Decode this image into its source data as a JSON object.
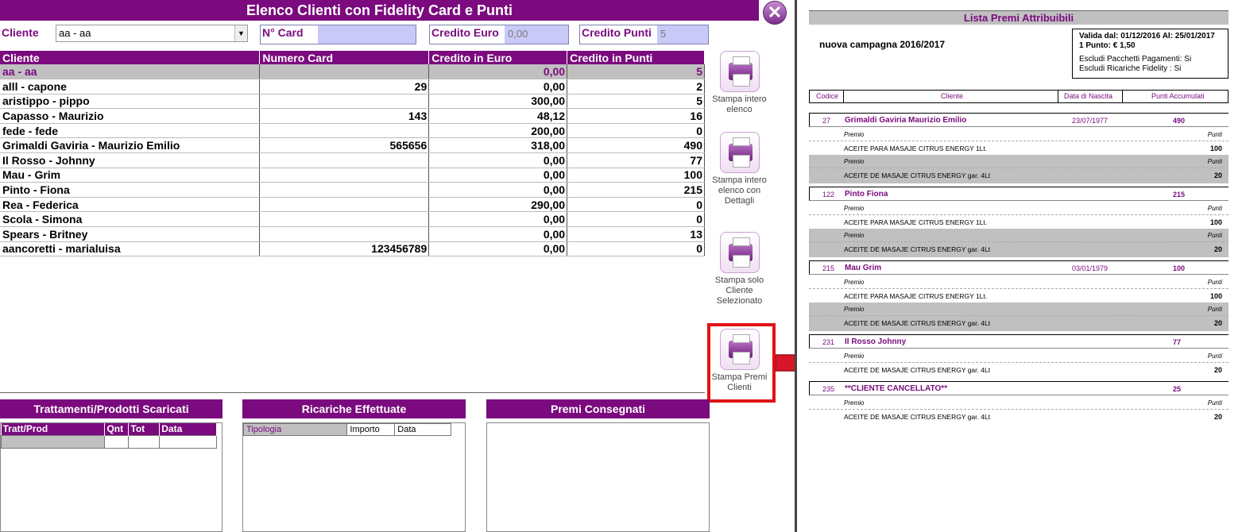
{
  "app": {
    "title": "Elenco Clienti con Fidelity Card e Punti",
    "close_icon": "close-icon"
  },
  "filters": {
    "cliente_label": "Cliente",
    "cliente_value": "aa - aa",
    "card_label": "N° Card",
    "card_value": "",
    "credito_euro_label": "Credito Euro",
    "credito_euro_value": "0,00",
    "credito_punti_label": "Credito Punti",
    "credito_punti_value": "5"
  },
  "table": {
    "headers": [
      "Cliente",
      "Numero Card",
      "Credito in Euro",
      "Credito in Punti"
    ],
    "rows": [
      {
        "cliente": "aa - aa",
        "card": "",
        "euro": "0,00",
        "punti": "5"
      },
      {
        "cliente": "alll - capone",
        "card": "29",
        "euro": "0,00",
        "punti": "2"
      },
      {
        "cliente": "aristippo - pippo",
        "card": "",
        "euro": "300,00",
        "punti": "5"
      },
      {
        "cliente": "Capasso - Maurizio",
        "card": "143",
        "euro": "48,12",
        "punti": "16"
      },
      {
        "cliente": "fede - fede",
        "card": "",
        "euro": "200,00",
        "punti": "0"
      },
      {
        "cliente": "Grimaldi Gaviria - Maurizio Emilio",
        "card": "565656",
        "euro": "318,00",
        "punti": "490"
      },
      {
        "cliente": "Il Rosso - Johnny",
        "card": "",
        "euro": "0,00",
        "punti": "77"
      },
      {
        "cliente": "Mau - Grim",
        "card": "",
        "euro": "0,00",
        "punti": "100"
      },
      {
        "cliente": "Pinto - Fiona",
        "card": "",
        "euro": "0,00",
        "punti": "215"
      },
      {
        "cliente": "Rea - Federica",
        "card": "",
        "euro": "290,00",
        "punti": "0"
      },
      {
        "cliente": "Scola - Simona",
        "card": "",
        "euro": "0,00",
        "punti": "0"
      },
      {
        "cliente": "Spears - Britney",
        "card": "",
        "euro": "0,00",
        "punti": "13"
      },
      {
        "cliente": "aancoretti - marialuisa",
        "card": "123456789",
        "euro": "0,00",
        "punti": "0"
      }
    ]
  },
  "side_buttons": {
    "b1": "Stampa intero elenco",
    "b2": "Stampa intero elenco con Dettagli",
    "b3": "Stampa solo Cliente Selezionato",
    "b4": "Stampa Premi Clienti"
  },
  "panels": {
    "trattamenti": {
      "title": "Trattamenti/Prodotti Scaricati",
      "headers": [
        "Tratt/Prod",
        "Qnt",
        "Tot",
        "Data"
      ]
    },
    "ricariche": {
      "title": "Ricariche Effettuate",
      "headers": [
        "Tipologia",
        "Importo",
        "Data"
      ]
    },
    "premi": {
      "title": "Premi Consegnati"
    }
  },
  "report": {
    "title": "Lista Premi Attribuibili",
    "campaign": "nuova campagna 2016/2017",
    "validity": "Valida dal: 01/12/2016 Al: 25/01/2017",
    "point_value": "1 Punto: € 1,50",
    "excl_pacchetti": "Escludi Pacchetti Pagamenti: Si",
    "excl_ricariche": "Escludi Ricariche Fidelity : Si",
    "col_headers": [
      "Codice",
      "Cliente",
      "Data di Nascita",
      "Punti Accumulati"
    ],
    "premio_label": "Premio",
    "punti_label": "Punti",
    "clients": [
      {
        "code": "27",
        "name": "Grimaldi Gaviria Maurizio Emilio",
        "dob": "23/07/1977",
        "points": "490",
        "items": [
          {
            "name": "ACEITE PARA MASAJE CITRUS ENERGY 1Lt.",
            "pts": "100"
          },
          {
            "name": "ACEITE DE MASAJE CITRUS ENERGY gar. 4Lt",
            "pts": "20"
          }
        ]
      },
      {
        "code": "122",
        "name": "Pinto Fiona",
        "dob": "",
        "points": "215",
        "items": [
          {
            "name": "ACEITE PARA MASAJE CITRUS ENERGY 1Lt.",
            "pts": "100"
          },
          {
            "name": "ACEITE DE MASAJE CITRUS ENERGY gar. 4Lt",
            "pts": "20"
          }
        ]
      },
      {
        "code": "215",
        "name": "Mau Grim",
        "dob": "03/01/1979",
        "points": "100",
        "items": [
          {
            "name": "ACEITE PARA MASAJE CITRUS ENERGY 1Lt.",
            "pts": "100"
          },
          {
            "name": "ACEITE DE MASAJE CITRUS ENERGY gar. 4Lt",
            "pts": "20"
          }
        ]
      },
      {
        "code": "231",
        "name": "Il Rosso Johnny",
        "dob": "",
        "points": "77",
        "items": [
          {
            "name": "ACEITE DE MASAJE CITRUS ENERGY gar. 4Lt",
            "pts": "20"
          }
        ]
      },
      {
        "code": "235",
        "name": "**CLIENTE CANCELLATO**",
        "dob": "",
        "points": "25",
        "items": [
          {
            "name": "ACEITE DE MASAJE CITRUS ENERGY gar. 4Lt",
            "pts": "20"
          }
        ]
      }
    ]
  },
  "colors": {
    "brand_purple": "#7a0a7e",
    "highlight_red": "#e01313",
    "field_blue": "#c9c9f7",
    "selected_gray": "#c0c0c0"
  }
}
